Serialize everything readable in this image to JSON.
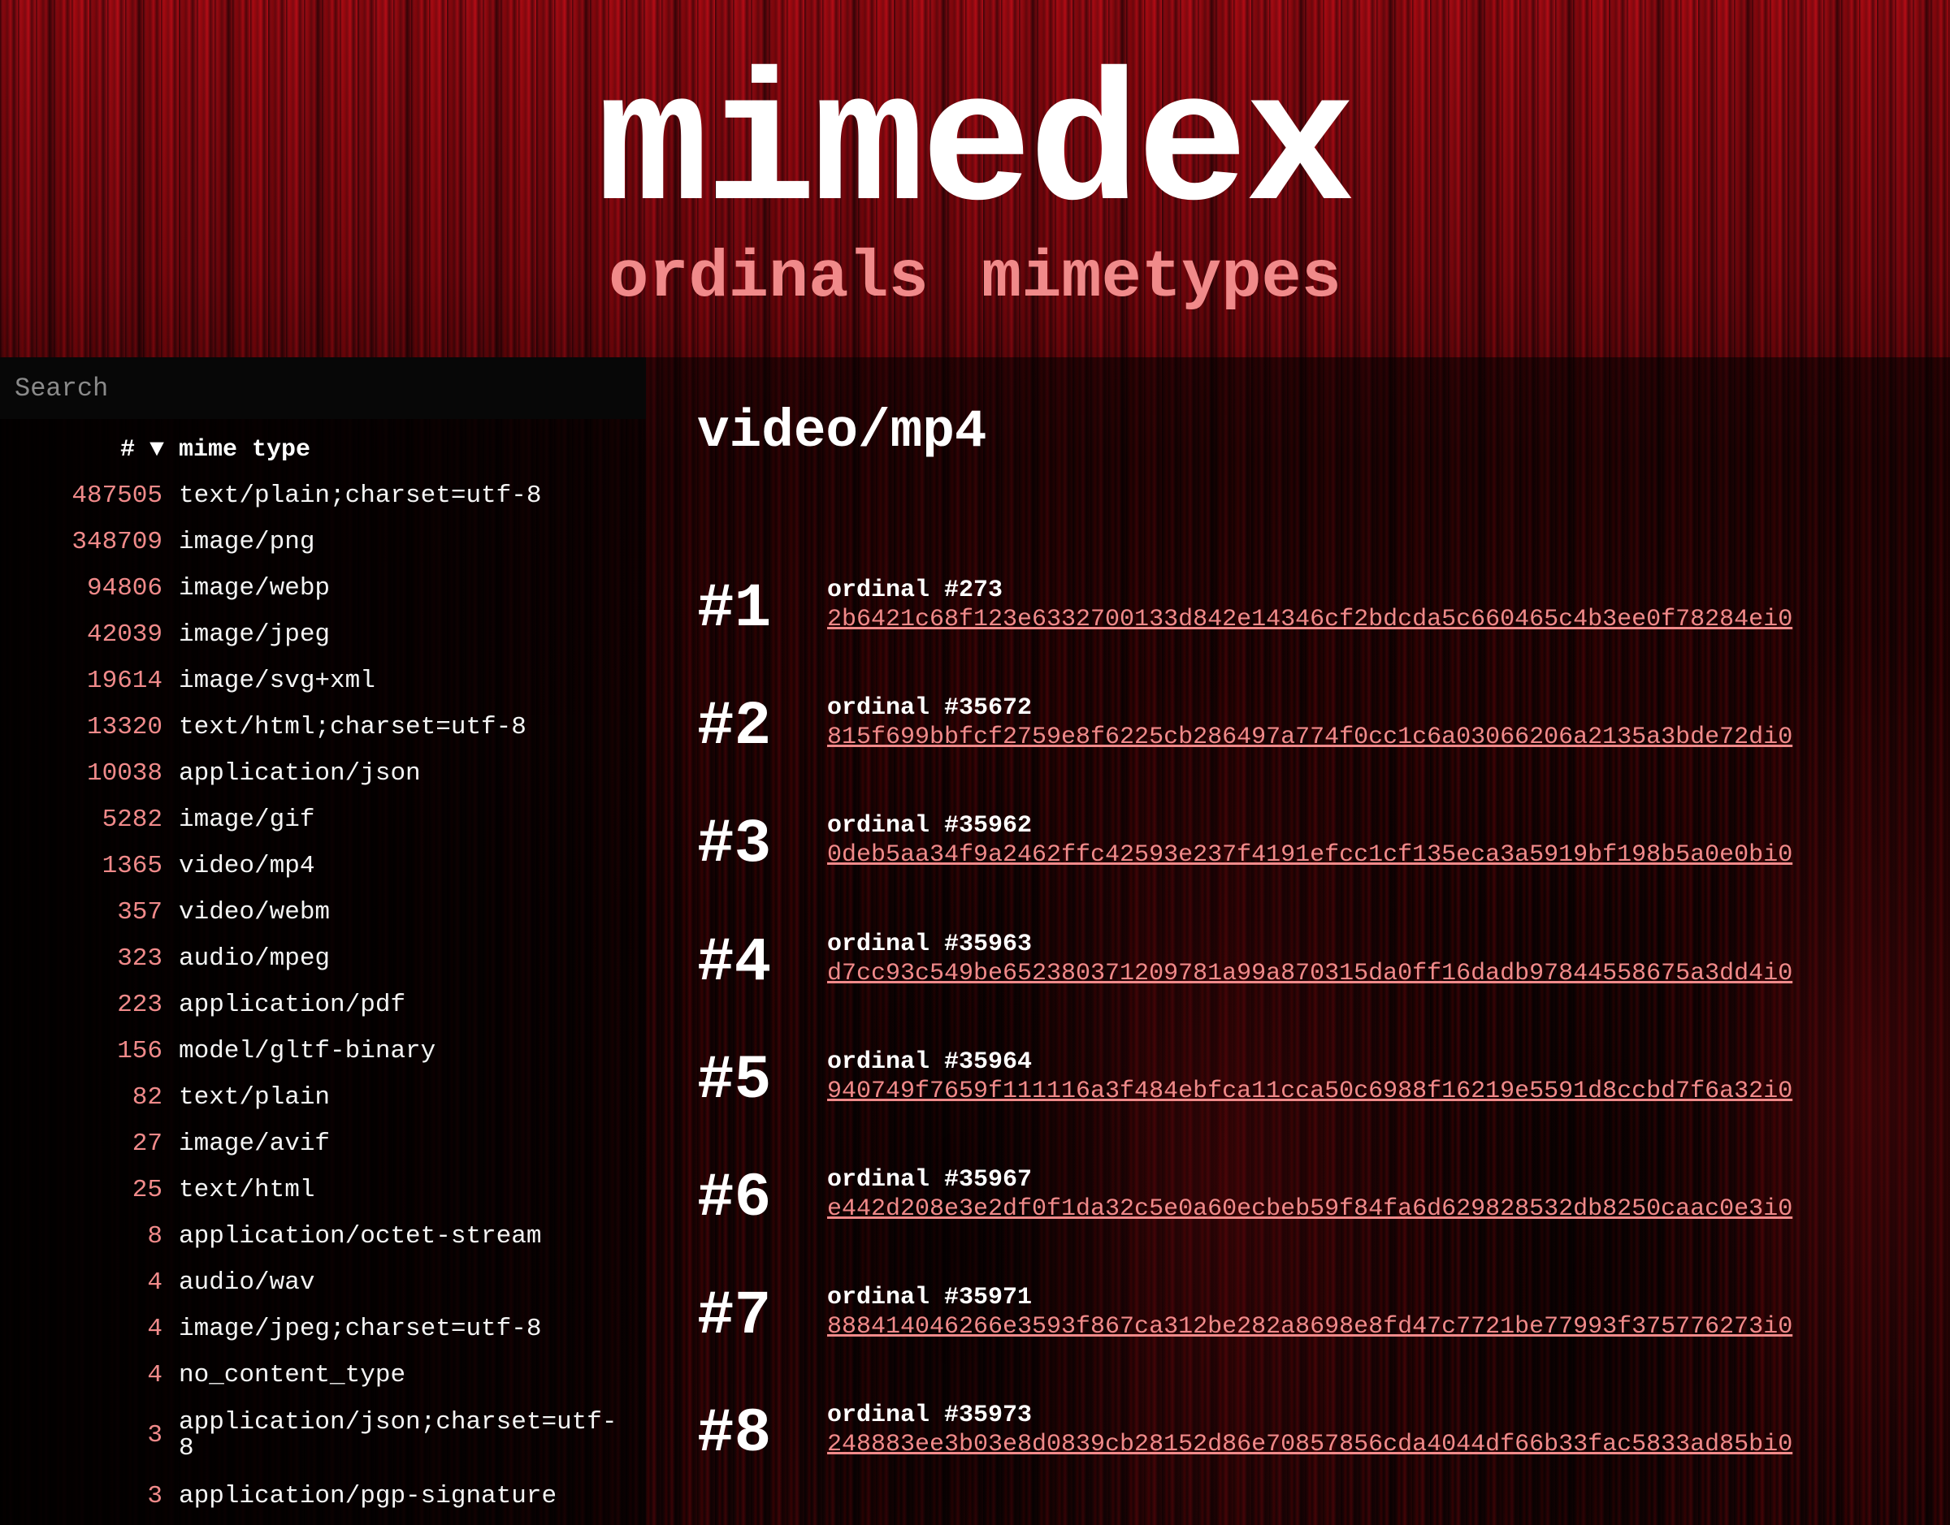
{
  "header": {
    "title": "mimedex",
    "nav": [
      {
        "label": "ordinals"
      },
      {
        "label": "mimetypes"
      }
    ]
  },
  "sidebar": {
    "search_placeholder": "Search",
    "columns": {
      "count": "# ▼",
      "type": "mime type"
    },
    "rows": [
      {
        "count": "487505",
        "type": "text/plain;charset=utf-8"
      },
      {
        "count": "348709",
        "type": "image/png"
      },
      {
        "count": "94806",
        "type": "image/webp"
      },
      {
        "count": "42039",
        "type": "image/jpeg"
      },
      {
        "count": "19614",
        "type": "image/svg+xml"
      },
      {
        "count": "13320",
        "type": "text/html;charset=utf-8"
      },
      {
        "count": "10038",
        "type": "application/json"
      },
      {
        "count": "5282",
        "type": "image/gif"
      },
      {
        "count": "1365",
        "type": "video/mp4"
      },
      {
        "count": "357",
        "type": "video/webm"
      },
      {
        "count": "323",
        "type": "audio/mpeg"
      },
      {
        "count": "223",
        "type": "application/pdf"
      },
      {
        "count": "156",
        "type": "model/gltf-binary"
      },
      {
        "count": "82",
        "type": "text/plain"
      },
      {
        "count": "27",
        "type": "image/avif"
      },
      {
        "count": "25",
        "type": "text/html"
      },
      {
        "count": "8",
        "type": "application/octet-stream"
      },
      {
        "count": "4",
        "type": "audio/wav"
      },
      {
        "count": "4",
        "type": "image/jpeg;charset=utf-8"
      },
      {
        "count": "4",
        "type": "no_content_type"
      },
      {
        "count": "3",
        "type": "application/json;charset=utf-8"
      },
      {
        "count": "3",
        "type": "application/pgp-signature"
      }
    ]
  },
  "main": {
    "mime_heading": "video/mp4",
    "results": [
      {
        "rank": "#1",
        "ordinal": "ordinal #273",
        "inscription": "2b6421c68f123e6332700133d842e14346cf2bdcda5c660465c4b3ee0f78284ei0"
      },
      {
        "rank": "#2",
        "ordinal": "ordinal #35672",
        "inscription": "815f699bbfcf2759e8f6225cb286497a774f0cc1c6a03066206a2135a3bde72di0"
      },
      {
        "rank": "#3",
        "ordinal": "ordinal #35962",
        "inscription": "0deb5aa34f9a2462ffc42593e237f4191efcc1cf135eca3a5919bf198b5a0e0bi0"
      },
      {
        "rank": "#4",
        "ordinal": "ordinal #35963",
        "inscription": "d7cc93c549be652380371209781a99a870315da0ff16dadb97844558675a3dd4i0"
      },
      {
        "rank": "#5",
        "ordinal": "ordinal #35964",
        "inscription": "940749f7659f111116a3f484ebfca11cca50c6988f16219e5591d8ccbd7f6a32i0"
      },
      {
        "rank": "#6",
        "ordinal": "ordinal #35967",
        "inscription": "e442d208e3e2df0f1da32c5e0a60ecbeb59f84fa6d629828532db8250caac0e3i0"
      },
      {
        "rank": "#7",
        "ordinal": "ordinal #35971",
        "inscription": "888414046266e3593f867ca312be282a8698e8fd47c7721be77993f375776273i0"
      },
      {
        "rank": "#8",
        "ordinal": "ordinal #35973",
        "inscription": "248883ee3b03e8d0839cb28152d86e70857856cda4044df66b33fac5833ad85bi0"
      }
    ]
  }
}
